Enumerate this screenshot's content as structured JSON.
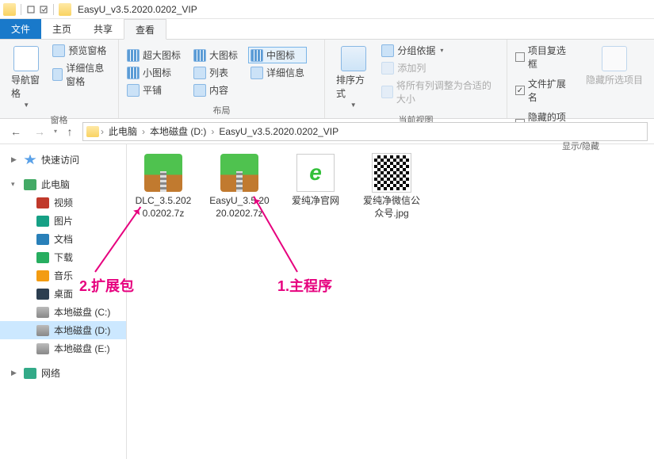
{
  "title_bar": {
    "title": "EasyU_v3.5.2020.0202_VIP"
  },
  "ribbon_tabs": {
    "file": "文件",
    "home": "主页",
    "share": "共享",
    "view": "查看"
  },
  "ribbon": {
    "pane": {
      "nav_pane": "导航窗格",
      "preview_pane": "预览窗格",
      "details_pane": "详细信息窗格",
      "label": "窗格"
    },
    "layout": {
      "extra_large": "超大图标",
      "large": "大图标",
      "medium": "中图标",
      "small": "小图标",
      "list": "列表",
      "details": "详细信息",
      "tiles": "平铺",
      "content": "内容",
      "label": "布局"
    },
    "current_view": {
      "sort": "排序方式",
      "group_by": "分组依据",
      "add_columns": "添加列",
      "size_all": "将所有列调整为合适的大小",
      "label": "当前视图"
    },
    "show_hide": {
      "item_checkbox": "项目复选框",
      "file_ext": "文件扩展名",
      "hidden_items": "隐藏的项目",
      "hide_selected": "隐藏所选项目",
      "label": "显示/隐藏"
    }
  },
  "breadcrumb": {
    "this_pc": "此电脑",
    "drive": "本地磁盘 (D:)",
    "folder": "EasyU_v3.5.2020.0202_VIP"
  },
  "sidebar": {
    "quick_access": "快速访问",
    "this_pc": "此电脑",
    "video": "视频",
    "pictures": "图片",
    "documents": "文档",
    "downloads": "下载",
    "music": "音乐",
    "desktop": "桌面",
    "disk_c": "本地磁盘 (C:)",
    "disk_d": "本地磁盘 (D:)",
    "disk_e": "本地磁盘 (E:)",
    "network": "网络"
  },
  "files": [
    {
      "name": "DLC_3.5.2020.0202.7z",
      "type": "archive"
    },
    {
      "name": "EasyU_3.5.2020.0202.7z",
      "type": "archive"
    },
    {
      "name": "爱纯净官网",
      "type": "web"
    },
    {
      "name": "爱纯净微信公众号.jpg",
      "type": "qr"
    }
  ],
  "annotations": {
    "a1": "1.主程序",
    "a2": "2.扩展包"
  }
}
